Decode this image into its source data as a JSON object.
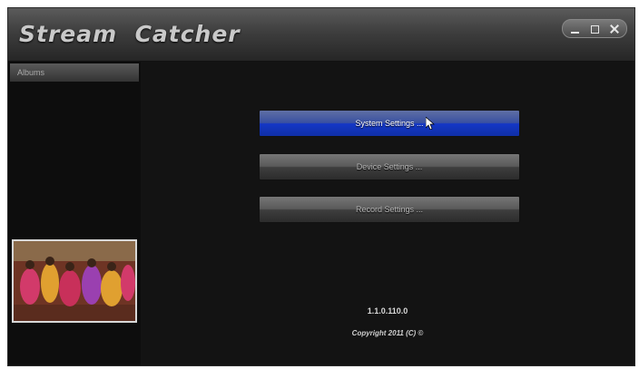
{
  "window": {
    "title": "Stream  Catcher",
    "controls": [
      "minimize-icon",
      "restore-icon",
      "close-icon"
    ]
  },
  "sidebar": {
    "header_label": "Albums",
    "thumbnail": {
      "description_icon": "video-thumbnail"
    }
  },
  "main": {
    "buttons": [
      {
        "label": "System Settings ...",
        "state": "active"
      },
      {
        "label": "Device Settings ...",
        "state": "normal"
      },
      {
        "label": "Record Settings ...",
        "state": "normal"
      }
    ],
    "version": "1.1.0.110.0",
    "copyright": "Copyright 2011 (C) ©"
  },
  "colors": {
    "accent_active": "#1437c6",
    "background": "#131313"
  }
}
